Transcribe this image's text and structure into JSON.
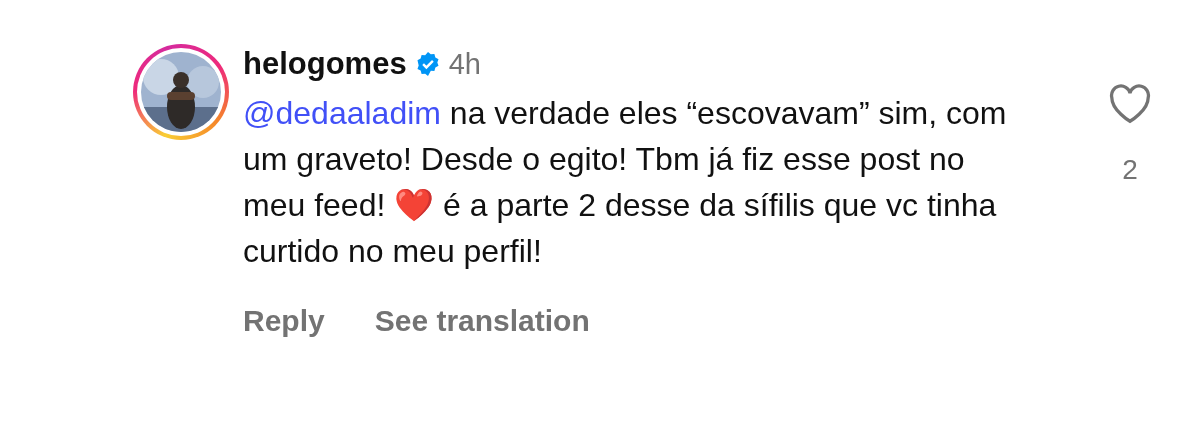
{
  "comment": {
    "username": "helogomes",
    "verified": true,
    "time": "4h",
    "mention": "@dedaaladim",
    "text": "na verdade eles “escovavam” sim, com um graveto! Desde o egito! Tbm já fiz esse post no meu feed!",
    "emoji": "❤️",
    "text_after": "é a parte 2 desse da sífilis que vc tinha curtido no meu perfil!",
    "liked": false,
    "like_count": "2",
    "actions": [
      "Reply",
      "See translation"
    ]
  }
}
